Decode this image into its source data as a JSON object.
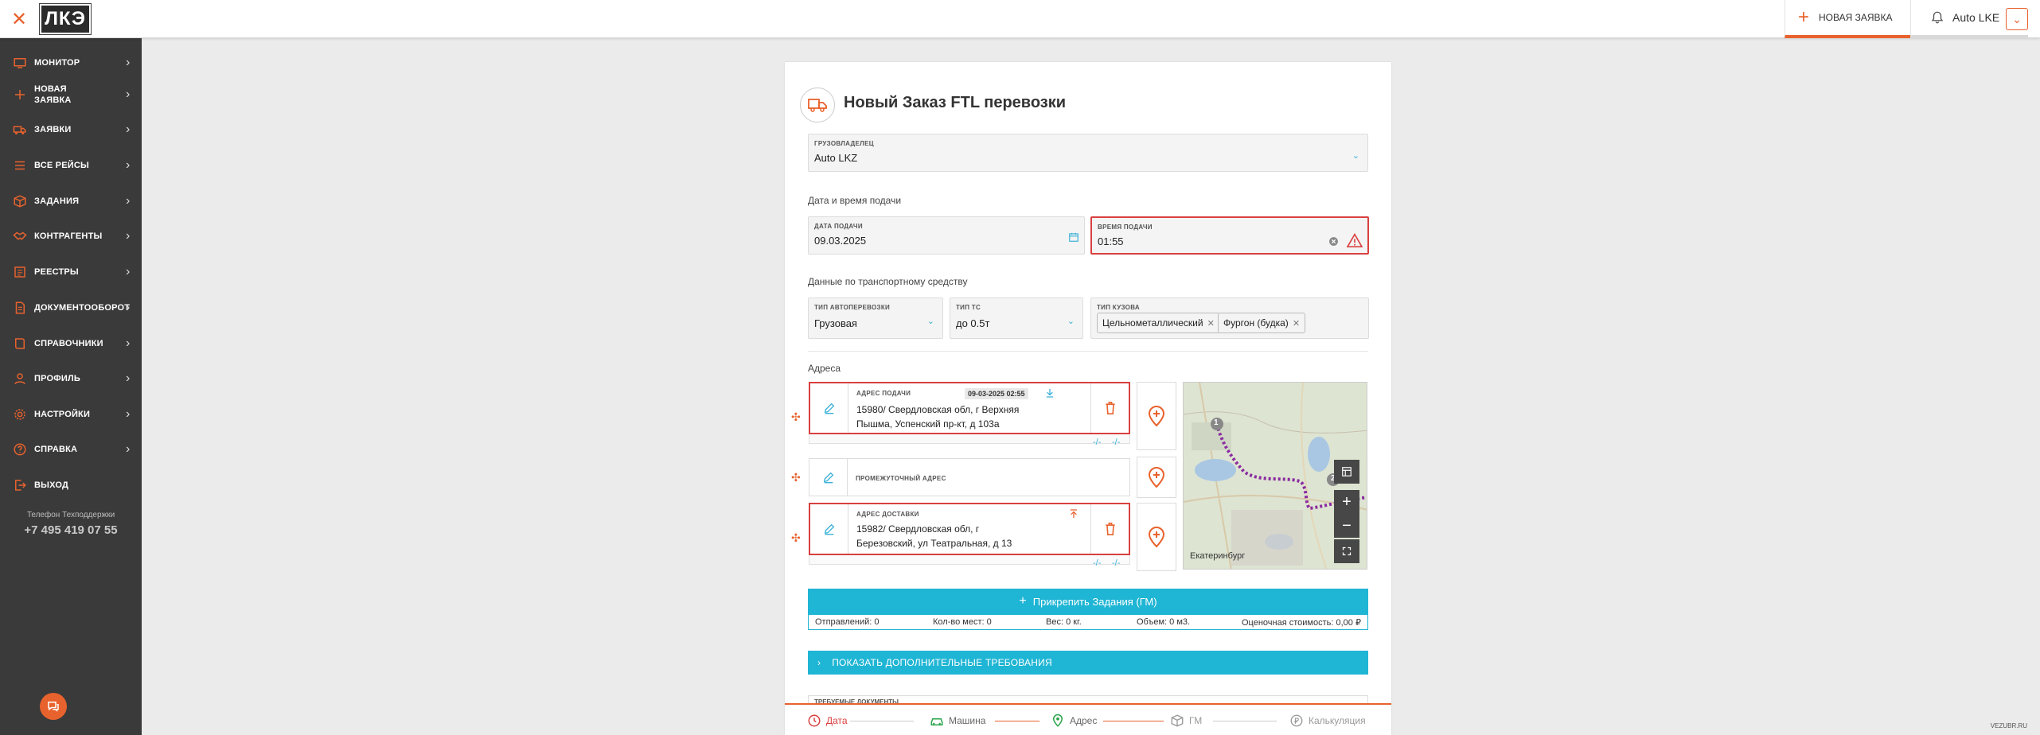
{
  "topbar": {
    "close_icon": "close-icon",
    "logo_text": "ЛКЭ",
    "new_order_tab": "НОВАЯ ЗАЯВКА",
    "user_name": "Auto LKE",
    "accent_color": "#e8622d"
  },
  "sidebar": {
    "items": [
      {
        "label": "МОНИТОР",
        "icon": "monitor-icon"
      },
      {
        "label": "НОВАЯ ЗАЯВКА",
        "icon": "plus-icon"
      },
      {
        "label": "ЗАЯВКИ",
        "icon": "truck-icon"
      },
      {
        "label": "ВСЕ РЕЙСЫ",
        "icon": "list-icon"
      },
      {
        "label": "ЗАДАНИЯ",
        "icon": "box-icon"
      },
      {
        "label": "КОНТРАГЕНТЫ",
        "icon": "handshake-icon"
      },
      {
        "label": "РЕЕСТРЫ",
        "icon": "registry-icon"
      },
      {
        "label": "ДОКУМЕНТООБОРОТ",
        "icon": "document-icon"
      },
      {
        "label": "СПРАВОЧНИКИ",
        "icon": "book-icon"
      },
      {
        "label": "ПРОФИЛЬ",
        "icon": "profile-icon"
      },
      {
        "label": "НАСТРОЙКИ",
        "icon": "gear-icon"
      },
      {
        "label": "СПРАВКА",
        "icon": "help-icon"
      },
      {
        "label": "ВЫХОД",
        "icon": "exit-icon"
      }
    ],
    "support_label": "Телефон Техподдержки",
    "support_phone": "+7 495 419 07 55"
  },
  "form": {
    "title": "Новый Заказ FTL перевозки",
    "cargo_owner_label": "ГРУЗОВЛАДЕЛЕЦ",
    "cargo_owner_value": "Auto LKZ",
    "datetime_section": "Дата и время подачи",
    "date_label": "ДАТА ПОДАЧИ",
    "date_value": "09.03.2025",
    "time_label": "ВРЕМЯ ПОДАЧИ",
    "time_value": "01:55",
    "vehicle_section": "Данные по транспортному средству",
    "transport_type_label": "ТИП АВТОПЕРЕВОЗКИ",
    "transport_type_value": "Грузовая",
    "vehicle_type_label": "ТИП ТС",
    "vehicle_type_value": "до 0.5т",
    "body_type_label": "ТИП КУЗОВА",
    "body_types": [
      "Цельнометаллический",
      "Фургон (будка)"
    ],
    "addresses_section": "Адреса",
    "pickup_label": "АДРЕС ПОДАЧИ",
    "pickup_datetime": "09-03-2025 02:55",
    "pickup_address": "15980/ Свердловская обл, г Верхняя Пышма, Успенский пр-кт, д 103а",
    "intermediate_label": "ПРОМЕЖУТОЧНЫЙ АДРЕС",
    "delivery_label": "АДРЕС ДОСТАВКИ",
    "delivery_address": "15982/ Свердловская обл, г Березовский, ул Театральная, д 13",
    "dim_placeholder": "-/-",
    "map_city": "Екатеринбург",
    "map_markers": [
      "1",
      "2"
    ],
    "attach_button": "Прикрепить Задания (ГМ)",
    "stats": {
      "sent": "Отправлений: 0",
      "places": "Кол-во мест: 0",
      "weight": "Вес: 0 кг.",
      "volume": "Объем: 0 м3.",
      "cost": "Оценочная стоимость: 0,00 ₽"
    },
    "extra_requirements": "ПОКАЗАТЬ ДОПОЛНИТЕЛЬНЫЕ ТРЕБОВАНИЯ",
    "required_docs": "ТРЕБУЕМЫЕ ДОКУМЕНТЫ"
  },
  "steps": [
    {
      "label": "Дата",
      "icon": "clock-icon"
    },
    {
      "label": "Машина",
      "icon": "car-icon"
    },
    {
      "label": "Адрес",
      "icon": "location-icon"
    },
    {
      "label": "ГМ",
      "icon": "cube-icon"
    },
    {
      "label": "Калькуляция",
      "icon": "coin-icon"
    }
  ],
  "watermark": "VEZUBR.RU"
}
